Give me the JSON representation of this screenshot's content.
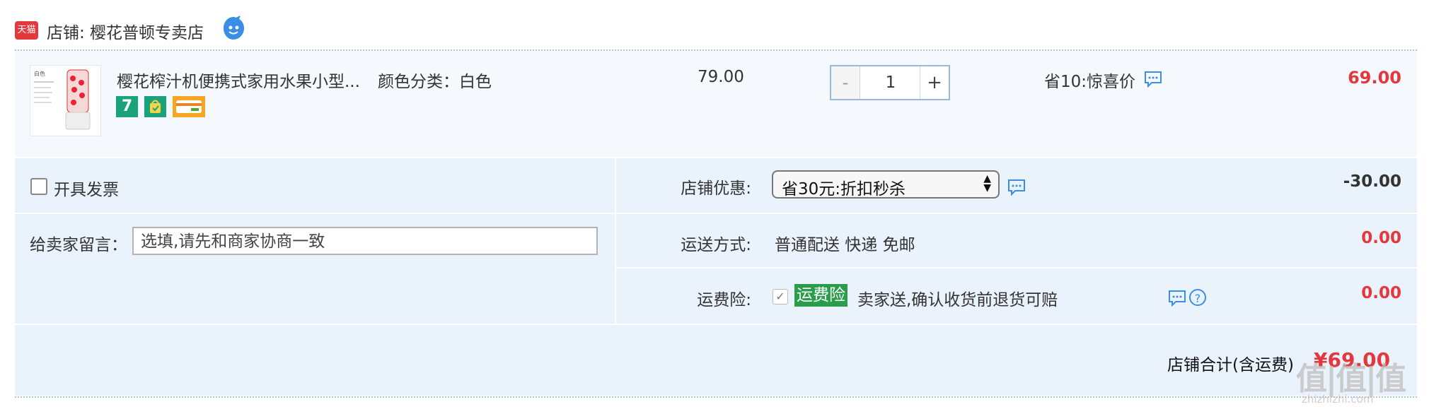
{
  "shop": {
    "platform_badge": "天猫",
    "label": "店铺: 樱花普顿专卖店"
  },
  "item": {
    "thumb_caption": "白色",
    "title": "樱花榨汁机便携式家用水果小型...",
    "sku": "颜色分类：白色",
    "badge_seven": "7",
    "price": "79.00",
    "qty_minus": "-",
    "qty_value": "1",
    "qty_plus": "+",
    "promo": "省10:惊喜价",
    "final_price": "69.00"
  },
  "options": {
    "invoice_label": "开具发票",
    "message_label": "给卖家留言：",
    "message_placeholder": "选填,请先和商家协商一致",
    "coupon_label": "店铺优惠:",
    "coupon_value": "省30元:折扣秒杀",
    "coupon_discount": "-30.00",
    "shipping_label": "运送方式:",
    "shipping_value": "普通配送 快递 免邮",
    "shipping_cost": "0.00",
    "insurance_label": "运费险:",
    "insurance_badge": "运费险",
    "insurance_text": "卖家送,确认收货前退货可赔",
    "insurance_cost": "0.00"
  },
  "total": {
    "label": "店铺合计(含运费)",
    "value": "¥69.00"
  },
  "watermark": {
    "text": "值|值|值",
    "site": "zhizhizhi.com"
  },
  "colors": {
    "accent_red": "#e4393c",
    "panel_blue": "#eaf2fb",
    "item_bg": "#f5f8fd",
    "insurance_green": "#2a9d4a",
    "icon_blue": "#3a8ee6"
  },
  "icons": [
    "tmall-logo",
    "wangwang-icon",
    "chat-icon",
    "help-icon",
    "checkmark-icon"
  ]
}
